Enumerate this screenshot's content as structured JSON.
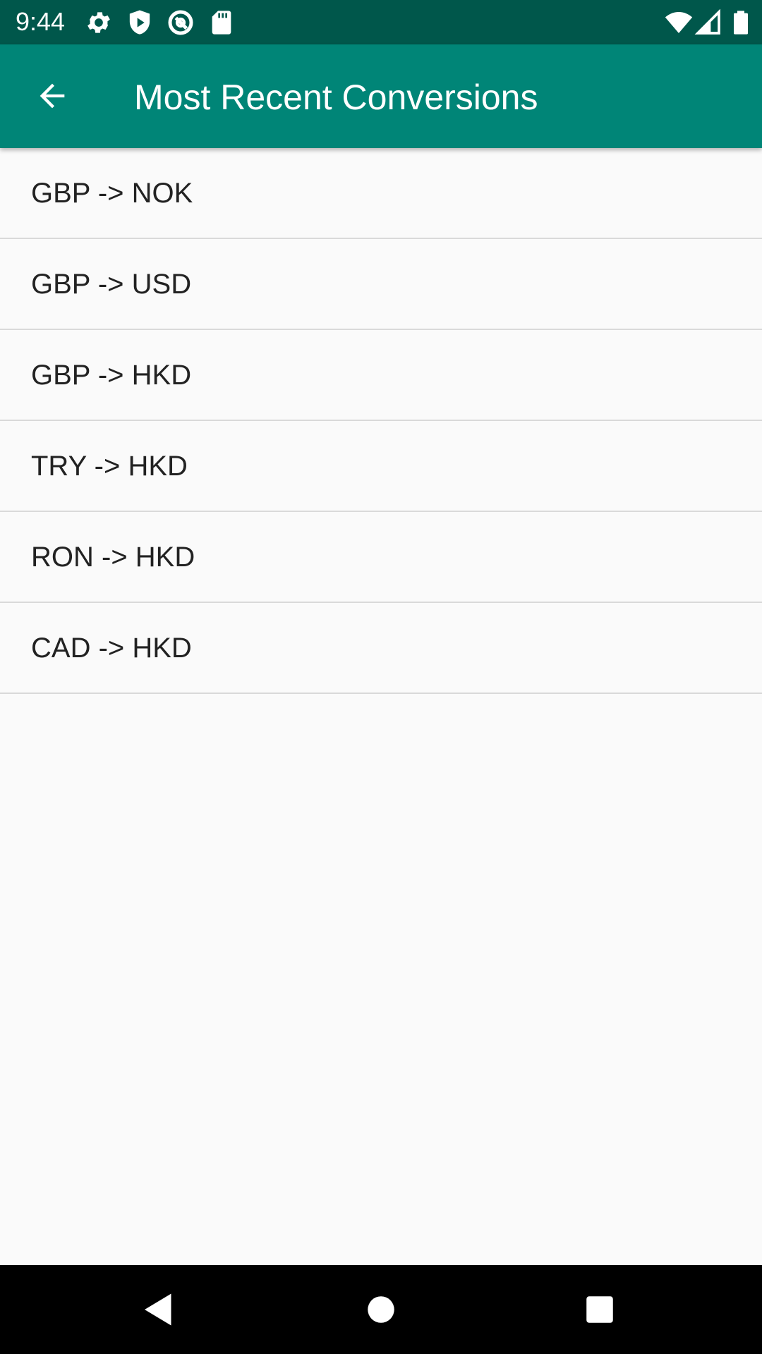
{
  "status_bar": {
    "time": "9:44",
    "icons": [
      "settings-icon",
      "shield-play-icon",
      "circle-at-icon",
      "sd-card-icon",
      "wifi-icon",
      "signal-icon",
      "battery-icon"
    ],
    "background": "#00574b"
  },
  "app_bar": {
    "title": "Most Recent Conversions",
    "back_icon": "arrow-left-icon",
    "background": "#008577"
  },
  "conversions": [
    {
      "label": "GBP -> NOK"
    },
    {
      "label": "GBP -> USD"
    },
    {
      "label": "GBP -> HKD"
    },
    {
      "label": "TRY -> HKD"
    },
    {
      "label": "RON -> HKD"
    },
    {
      "label": "CAD -> HKD"
    }
  ],
  "nav_bar": {
    "icons": [
      "back-triangle-icon",
      "home-circle-icon",
      "recents-square-icon"
    ]
  }
}
